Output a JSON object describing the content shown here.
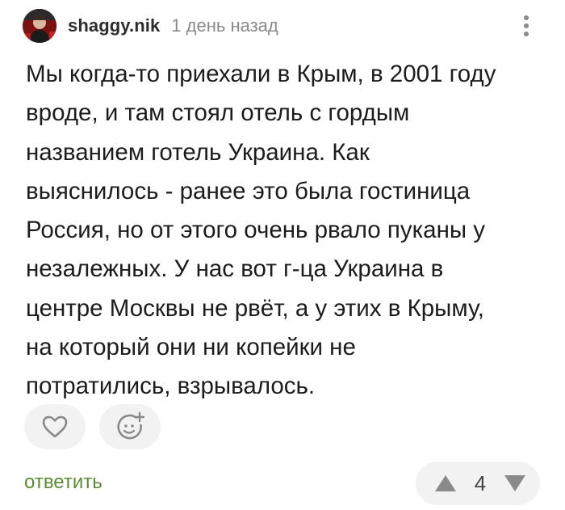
{
  "comment": {
    "author": "shaggy.nik",
    "time_ago": "1 день назад",
    "text": "Мы когда-то приехали в Крым, в 2001 году\nвроде, и там стоял отель с гордым\nназванием готель Украина. Как\nвыяснилось - ранее это была гостиница\nРоссия, но от этого очень рвало пуканы у\nнезалежных. У нас вот г-ца Украина в\nцентре Москвы не рвёт, а у этих в Крыму,\nна который они ни копейки не\nпотратились, взрывалось."
  },
  "actions": {
    "reply_label": "ответить",
    "rating": "4"
  },
  "icons": {
    "avatar": "user-avatar",
    "more": "more-vertical-icon",
    "like": "heart-icon",
    "emoji": "emoji-add-icon",
    "vote_up": "triangle-up-icon",
    "vote_down": "triangle-down-icon"
  },
  "colors": {
    "reply": "#5b8c34",
    "icon_gray": "#8a8a8a",
    "button_bg": "#f2f2f2"
  }
}
